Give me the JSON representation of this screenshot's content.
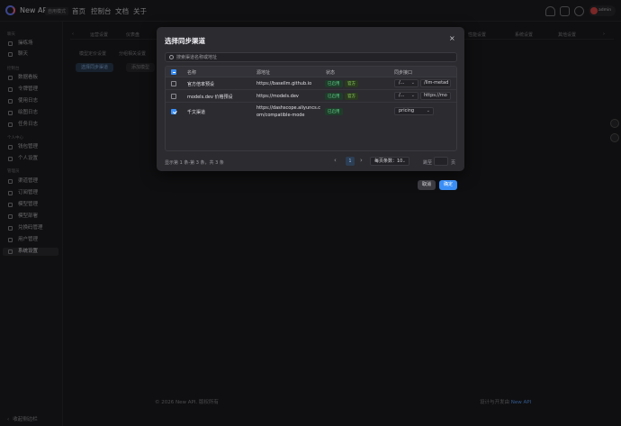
{
  "header": {
    "app_name": "New API",
    "badge": "自用模式",
    "nav": [
      "首页",
      "控制台",
      "文档",
      "关于"
    ],
    "user": "admin"
  },
  "sidebar": {
    "groups": [
      {
        "label": "聊天",
        "items": [
          {
            "label": "操练场"
          },
          {
            "label": "聊天"
          }
        ]
      },
      {
        "label": "控制台",
        "items": [
          {
            "label": "数据看板"
          },
          {
            "label": "令牌管理"
          },
          {
            "label": "使用日志"
          },
          {
            "label": "绘图日志"
          },
          {
            "label": "任务日志"
          }
        ]
      },
      {
        "label": "个人中心",
        "items": [
          {
            "label": "钱包管理"
          },
          {
            "label": "个人设置"
          }
        ]
      },
      {
        "label": "管理员",
        "items": [
          {
            "label": "渠道管理"
          },
          {
            "label": "订阅管理"
          },
          {
            "label": "模型管理"
          },
          {
            "label": "模型部署"
          },
          {
            "label": "兑换码管理"
          },
          {
            "label": "用户管理"
          },
          {
            "label": "系统设置"
          }
        ]
      }
    ],
    "collapse_label": "收起侧边栏"
  },
  "background": {
    "tabs": [
      "运营设置",
      "仪表盘",
      "性能设置",
      "系统设置",
      "其他设置"
    ],
    "sub_tabs": [
      "模型定价设置",
      "分组相关设置"
    ],
    "sync_button": "选择同步渠道",
    "second_button": "添加模型"
  },
  "modal": {
    "title": "选择同步渠道",
    "close": "×",
    "search_placeholder": "搜索渠道名称或地址",
    "columns": [
      "名称",
      "源地址",
      "状态",
      "同步接口"
    ],
    "rows": [
      {
        "name": "官方倍率预设",
        "url_line1": "https://basellm.github.io",
        "url_line2": "",
        "status": "已启用",
        "tag": "官方",
        "sync_select": "/...",
        "sync_input": "/llm-metad",
        "checked": false
      },
      {
        "name": "models.dev 价格预设",
        "url_line1": "https://models.dev",
        "url_line2": "",
        "status": "已启用",
        "tag": "官方",
        "sync_select": "/...",
        "sync_input": "https://mo",
        "checked": false
      },
      {
        "name": "千文渠道",
        "url_line1": "https://dashscope.aliyuncs.c",
        "url_line2": "om/compatible-mode",
        "status": "已启用",
        "tag": "",
        "sync_select": "pricing",
        "sync_input": "",
        "checked": true
      }
    ],
    "pager": {
      "info": "显示第 1 条-第 3 条，共 3 条",
      "prev": "‹",
      "next": "›",
      "current": "1",
      "page_size": "每页条数：10",
      "jump_label": "跳至",
      "page_label": "页"
    },
    "cancel": "取消",
    "confirm": "确定"
  },
  "footer": {
    "copyright": "© 2026 New API. 版权所有",
    "designed_prefix": "设计与开发由",
    "designed_link": "New API"
  }
}
